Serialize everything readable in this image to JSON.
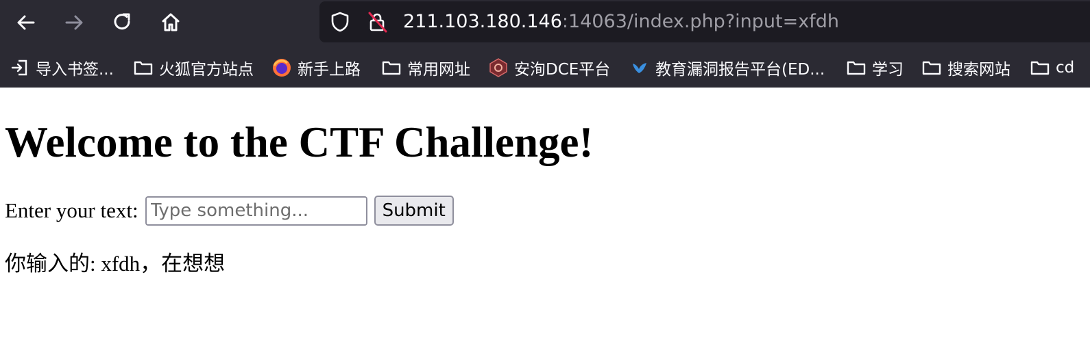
{
  "url": {
    "host": "211.103.180.146",
    "rest": ":14063/index.php?input=xfdh"
  },
  "bookmarks": [
    {
      "label": "导入书签...",
      "icon": "import-icon"
    },
    {
      "label": "火狐官方站点",
      "icon": "folder-icon"
    },
    {
      "label": "新手上路",
      "icon": "firefox-logo-icon"
    },
    {
      "label": "常用网址",
      "icon": "folder-icon"
    },
    {
      "label": "安洵DCE平台",
      "icon": "shield-logo-icon"
    },
    {
      "label": "教育漏洞报告平台(ED...",
      "icon": "bird-logo-icon"
    },
    {
      "label": "学习",
      "icon": "folder-icon"
    },
    {
      "label": "搜索网站",
      "icon": "folder-icon"
    },
    {
      "label": "cd",
      "icon": "folder-icon"
    }
  ],
  "page": {
    "heading": "Welcome to the CTF Challenge!",
    "form_label": "Enter your text:",
    "input_placeholder": "Type something...",
    "submit_label": "Submit",
    "result_text": "你输入的: xfdh，在想想"
  },
  "colors": {
    "toolbar_bg": "#2b2a33",
    "urlbar_bg": "#1c1b22",
    "url_host": "#fbfbfe",
    "url_rest": "#9f9ea6"
  }
}
